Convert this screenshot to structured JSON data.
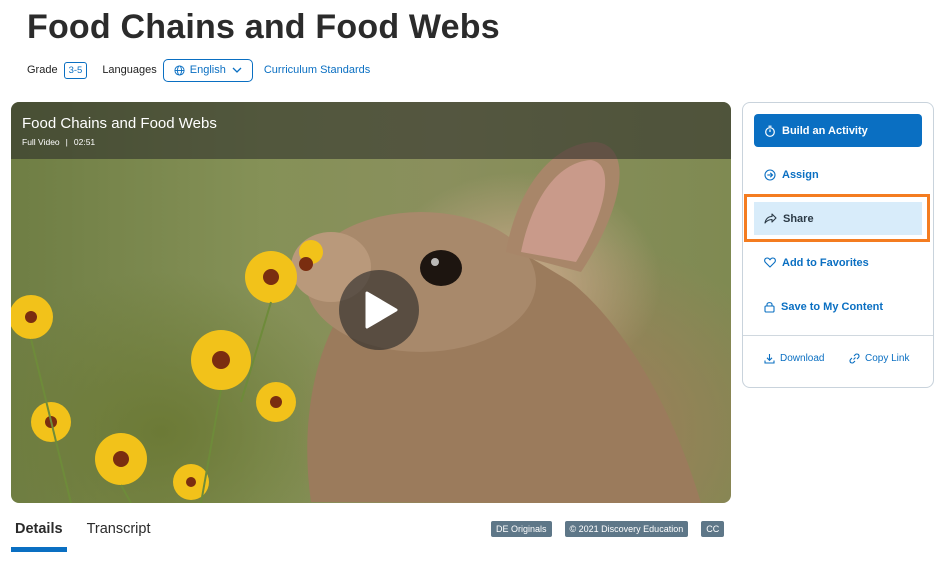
{
  "header": {
    "title": "Food Chains and Food Webs",
    "grade_label": "Grade",
    "grade_value": "3-5",
    "languages_label": "Languages",
    "language_selected": "English",
    "curriculum_link": "Curriculum Standards"
  },
  "video": {
    "title": "Food Chains and Food Webs",
    "type": "Full Video",
    "separator": "|",
    "duration": "02:51"
  },
  "actions": {
    "build": "Build an Activity",
    "assign": "Assign",
    "share": "Share",
    "favorites": "Add to Favorites",
    "save": "Save to My Content",
    "download": "Download",
    "copy_link": "Copy Link"
  },
  "tabs": [
    {
      "label": "Details"
    },
    {
      "label": "Transcript"
    }
  ],
  "tags": [
    "DE Originals",
    "© 2021 Discovery Education",
    "CC"
  ],
  "colors": {
    "accent": "#0a6fc2",
    "share_bg": "#d8ecfa",
    "highlight": "#f47c20",
    "tag_bg": "#5e7788"
  },
  "icons": [
    "globe-icon",
    "chevron-down-icon",
    "play-icon",
    "stopwatch-icon",
    "arrow-circle-icon",
    "share-arrow-icon",
    "heart-icon",
    "lock-icon",
    "download-icon",
    "link-icon"
  ]
}
